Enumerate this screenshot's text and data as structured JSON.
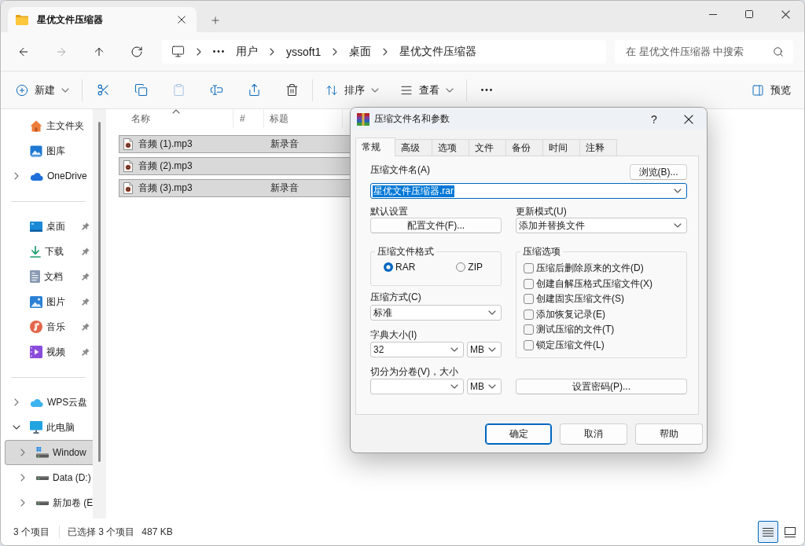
{
  "tabs": [
    {
      "label": "星优文件压缩器",
      "selected": true
    }
  ],
  "nav": [
    {
      "disabled": false
    },
    {
      "disabled": true
    },
    {
      "disabled": false
    },
    {
      "disabled": false
    }
  ],
  "address_bar": {
    "crumbs": [
      "用户",
      "yssoft1",
      "桌面",
      "星优文件压缩器"
    ]
  },
  "search": {
    "placeholder": "在 星优文件压缩器 中搜索"
  },
  "toolbar": {
    "new": {
      "label": "新建"
    },
    "paste": {
      "disabled": true
    },
    "sort": {
      "label": "排序"
    },
    "view": {
      "label": "查看"
    },
    "preview": {
      "label": "预览"
    }
  },
  "sidebar": {
    "sections": [
      {
        "items": [
          {
            "label": "主文件夹",
            "selected": false
          },
          {
            "label": "图库",
            "selected": false
          },
          {
            "label": "OneDrive",
            "expanded": false,
            "selected": false
          }
        ]
      },
      {
        "items": [
          {
            "label": "桌面",
            "pinned": true,
            "selected": false
          },
          {
            "label": "下载",
            "pinned": true,
            "selected": false
          },
          {
            "label": "文档",
            "pinned": true,
            "selected": false
          },
          {
            "label": "图片",
            "pinned": true,
            "selected": false
          },
          {
            "label": "音乐",
            "pinned": true,
            "selected": false
          },
          {
            "label": "视频",
            "pinned": true,
            "selected": false
          }
        ]
      },
      {
        "items": [
          {
            "label": "WPS云盘",
            "expanded": false,
            "selected": false
          },
          {
            "label": "此电脑",
            "expanded": true,
            "selected": false,
            "children": [
              {
                "label": "Window",
                "expanded": false,
                "selected": true
              },
              {
                "label": "Data (D:)",
                "expanded": false,
                "selected": false
              },
              {
                "label": "新加卷 (E",
                "expanded": false,
                "selected": false
              }
            ]
          }
        ]
      }
    ]
  },
  "file_list": {
    "columns": [
      {
        "label": "名称",
        "sorted": true
      },
      {
        "label": "#",
        "sorted": false
      },
      {
        "label": "标题",
        "sorted": false
      }
    ],
    "rows": [
      {
        "name": "音频 (1).mp3",
        "title": "新录音",
        "selected": true
      },
      {
        "name": "音频 (2).mp3",
        "selected": true
      },
      {
        "name": "音频 (3).mp3",
        "title": "新录音",
        "selected": true
      }
    ]
  },
  "status_bar": {
    "item_count": "3 个项目",
    "selection": "已选择 3 个项目",
    "size": "487 KB",
    "views": [
      {
        "selected": true
      },
      {
        "selected": false
      }
    ]
  },
  "dialog": {
    "title": "压缩文件名和参数",
    "help_button": "?",
    "tabs": [
      {
        "label": "常规",
        "selected": true
      },
      {
        "label": "高级",
        "selected": false
      },
      {
        "label": "选项",
        "selected": false
      },
      {
        "label": "文件",
        "selected": false
      },
      {
        "label": "备份",
        "selected": false
      },
      {
        "label": "时间",
        "selected": false
      },
      {
        "label": "注释",
        "selected": false
      }
    ],
    "archive_name": {
      "label": "压缩文件名(A)",
      "value": "星优文件压缩器.rar",
      "focused": true,
      "browse_button": "浏览(B)..."
    },
    "profiles": {
      "label": "默认设置",
      "button": "配置文件(F)..."
    },
    "update_mode": {
      "label": "更新模式(U)",
      "value": "添加并替换文件"
    },
    "format": {
      "label": "压缩文件格式",
      "options": [
        {
          "label": "RAR",
          "selected": true
        },
        {
          "label": "ZIP",
          "selected": false
        }
      ]
    },
    "method": {
      "label": "压缩方式(C)",
      "value": "标准"
    },
    "dictionary": {
      "label": "字典大小(I)",
      "value": "32",
      "unit": "MB"
    },
    "split": {
      "label": "切分为分卷(V)，大小",
      "unit": "MB"
    },
    "options": {
      "label": "压缩选项",
      "items": [
        {
          "label": "压缩后删除原来的文件(D)",
          "checked": false
        },
        {
          "label": "创建自解压格式压缩文件(X)",
          "checked": false
        },
        {
          "label": "创建固实压缩文件(S)",
          "checked": false
        },
        {
          "label": "添加恢复记录(E)",
          "checked": false
        },
        {
          "label": "测试压缩的文件(T)",
          "checked": false
        },
        {
          "label": "锁定压缩文件(L)",
          "checked": false
        }
      ]
    },
    "password_button": "设置密码(P)...",
    "buttons": [
      {
        "label": "确定",
        "default": true
      },
      {
        "label": "取消",
        "default": false
      },
      {
        "label": "帮助",
        "default": false
      }
    ]
  }
}
